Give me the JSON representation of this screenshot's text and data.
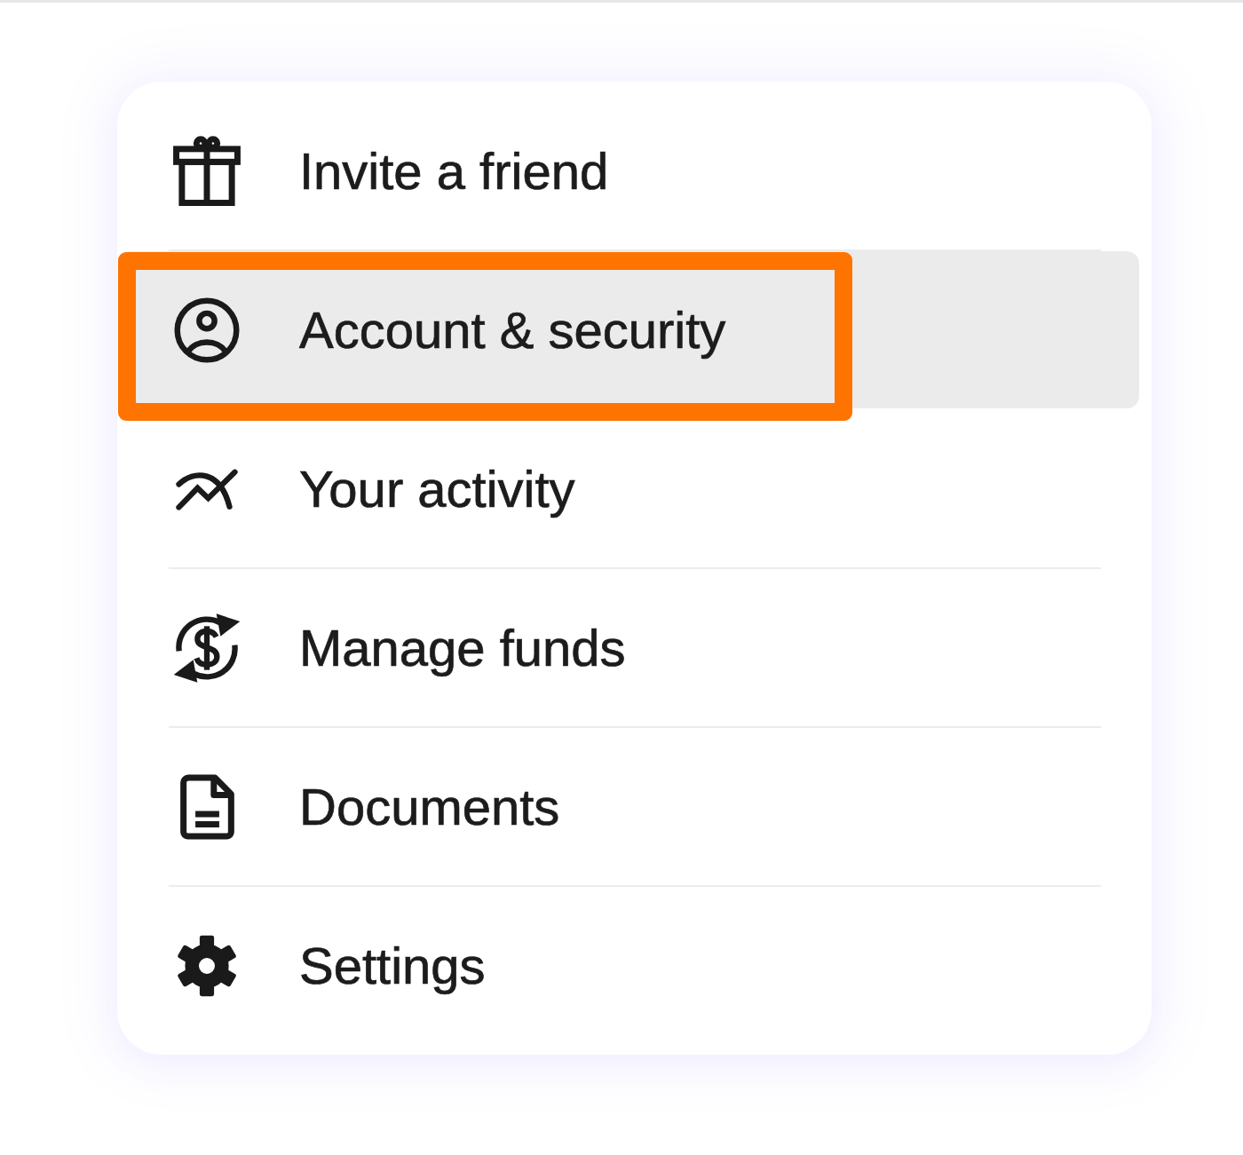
{
  "menu": {
    "items": [
      {
        "kind": "invite",
        "label": "Invite a friend",
        "selected": false,
        "callout": false
      },
      {
        "kind": "account",
        "label": "Account & security",
        "selected": true,
        "callout": true
      },
      {
        "kind": "activity",
        "label": "Your activity",
        "selected": false,
        "callout": false
      },
      {
        "kind": "funds",
        "label": "Manage funds",
        "selected": false,
        "callout": false
      },
      {
        "kind": "documents",
        "label": "Documents",
        "selected": false,
        "callout": false
      },
      {
        "kind": "settings",
        "label": "Settings",
        "selected": false,
        "callout": false
      }
    ]
  }
}
